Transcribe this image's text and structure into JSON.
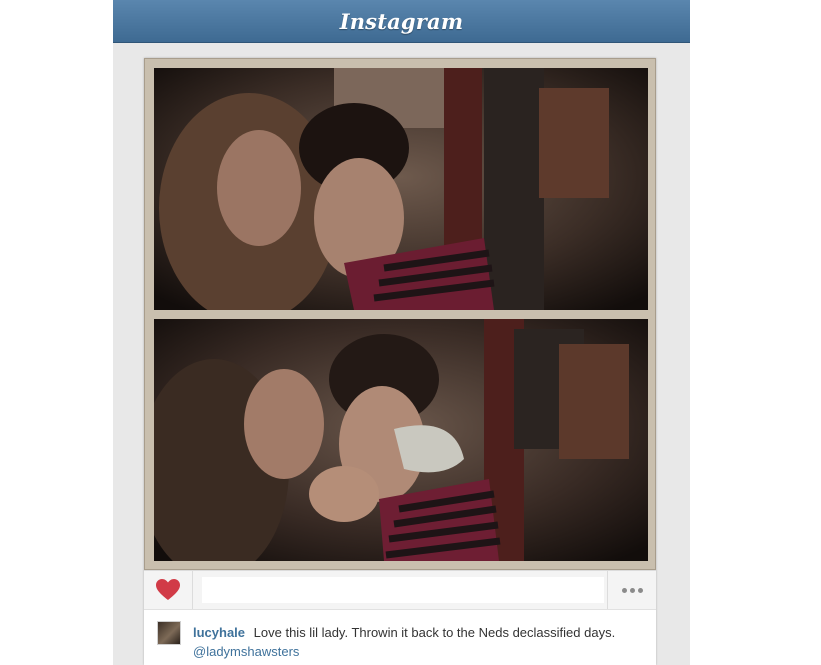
{
  "header": {
    "brand": "Instagram"
  },
  "colors": {
    "header_blue": "#4a76a0",
    "link_blue": "#3f729b",
    "heart_red": "#d13b47",
    "background": "#e8e8e8"
  },
  "post": {
    "icons": {
      "like": "heart-icon",
      "more": "more-options-icon"
    },
    "comment_input": {
      "value": "",
      "placeholder": ""
    },
    "caption": {
      "username": "lucyhale",
      "text": "Love this lil lady. Throwin it back to the Neds declassified days.",
      "mention": "@ladymshawsters"
    }
  }
}
